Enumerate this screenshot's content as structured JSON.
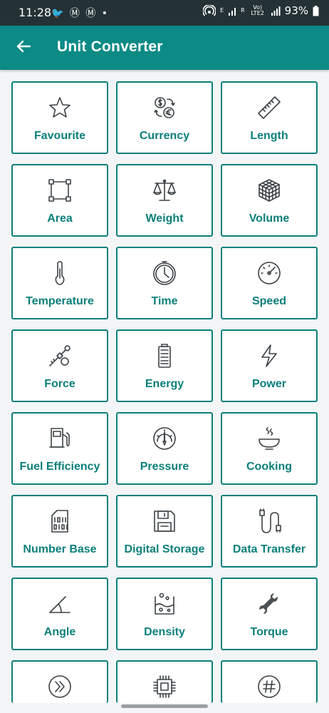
{
  "status_bar": {
    "time": "11:28",
    "notif_icons": "🐦 Ⓜ Ⓜ •",
    "network_e": "E",
    "network_r": "R",
    "volte_label": "Vo) LTE2",
    "battery": "93%"
  },
  "app_bar": {
    "title": "Unit Converter",
    "back_icon": "arrow-left-icon"
  },
  "colors": {
    "accent": "#0b8a86",
    "label": "#0b7f7b",
    "icon": "#3d4246",
    "status": "#243236"
  },
  "categories": [
    {
      "label": "Favourite",
      "icon": "star-icon"
    },
    {
      "label": "Currency",
      "icon": "currency-icon"
    },
    {
      "label": "Length",
      "icon": "ruler-icon"
    },
    {
      "label": "Area",
      "icon": "area-icon"
    },
    {
      "label": "Weight",
      "icon": "scale-icon"
    },
    {
      "label": "Volume",
      "icon": "cube-icon"
    },
    {
      "label": "Temperature",
      "icon": "thermometer-icon"
    },
    {
      "label": "Time",
      "icon": "clock-icon"
    },
    {
      "label": "Speed",
      "icon": "speedometer-icon"
    },
    {
      "label": "Force",
      "icon": "force-icon"
    },
    {
      "label": "Energy",
      "icon": "battery-icon"
    },
    {
      "label": "Power",
      "icon": "lightning-icon"
    },
    {
      "label": "Fuel Efficiency",
      "icon": "fuel-pump-icon"
    },
    {
      "label": "Pressure",
      "icon": "gauge-icon"
    },
    {
      "label": "Cooking",
      "icon": "bowl-icon"
    },
    {
      "label": "Number Base",
      "icon": "sd-card-binary-icon"
    },
    {
      "label": "Digital Storage",
      "icon": "floppy-disk-icon"
    },
    {
      "label": "Data Transfer",
      "icon": "cable-icon"
    },
    {
      "label": "Angle",
      "icon": "angle-icon"
    },
    {
      "label": "Density",
      "icon": "beaker-icon"
    },
    {
      "label": "Torque",
      "icon": "wrench-icon"
    }
  ],
  "partial_row_icons": [
    "fast-forward-circle-icon",
    "chip-icon",
    "hash-circle-icon"
  ]
}
